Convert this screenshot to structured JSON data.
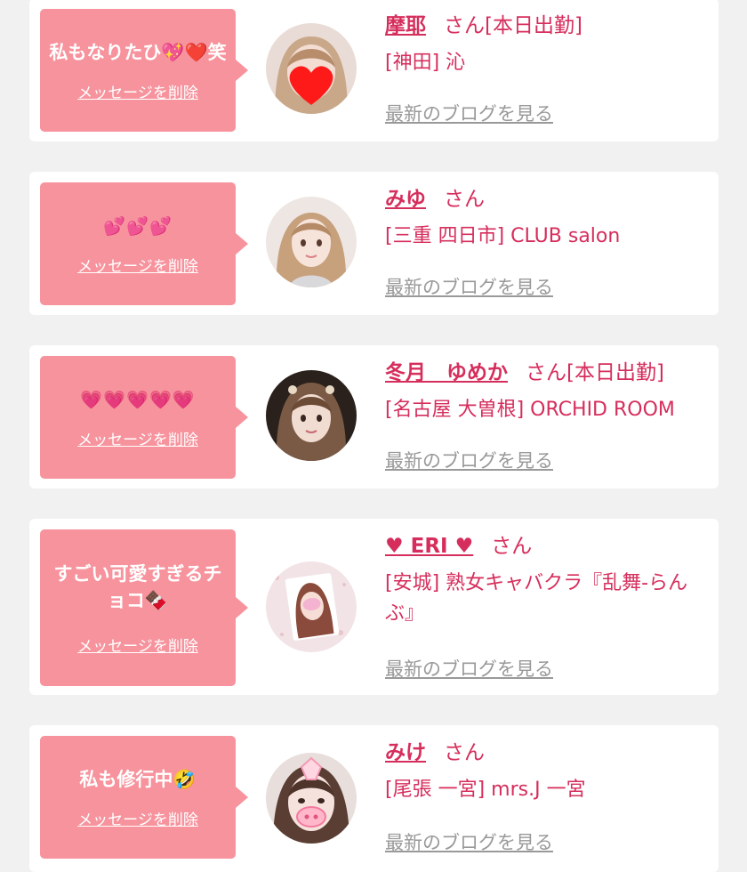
{
  "colors": {
    "bubble": "#f7939d",
    "name_text": "#d62e5c",
    "blog_link": "#999999",
    "card": "#ffffff",
    "background": "#f1f1f1"
  },
  "delete_label": "メッセージを削除",
  "blog_label": "最新のブログを見る",
  "entries": [
    {
      "message": "私もなりたひ💖❤️笑",
      "name": "摩耶",
      "san_suffix": "さん[本日出勤]",
      "shop": "[神田] 沁"
    },
    {
      "message": "💕💕💕",
      "name": "みゆ",
      "san_suffix": "さん",
      "shop": "[三重 四日市] CLUB salon"
    },
    {
      "message": "💗💗💗💗💗",
      "name": "冬月　ゆめか",
      "san_suffix": "さん[本日出勤]",
      "shop": "[名古屋 大曽根] ORCHID ROOM"
    },
    {
      "message": "すごい可愛すぎるチョコ🍫",
      "name": "♥ ERI ♥",
      "san_suffix": "さん",
      "shop": "[安城] 熟女キャバクラ『乱舞-らんぶ』"
    },
    {
      "message": "私も修行中🤣",
      "name": "みけ",
      "san_suffix": "さん",
      "shop": "[尾張 一宮] mrs.J 一宮"
    }
  ]
}
